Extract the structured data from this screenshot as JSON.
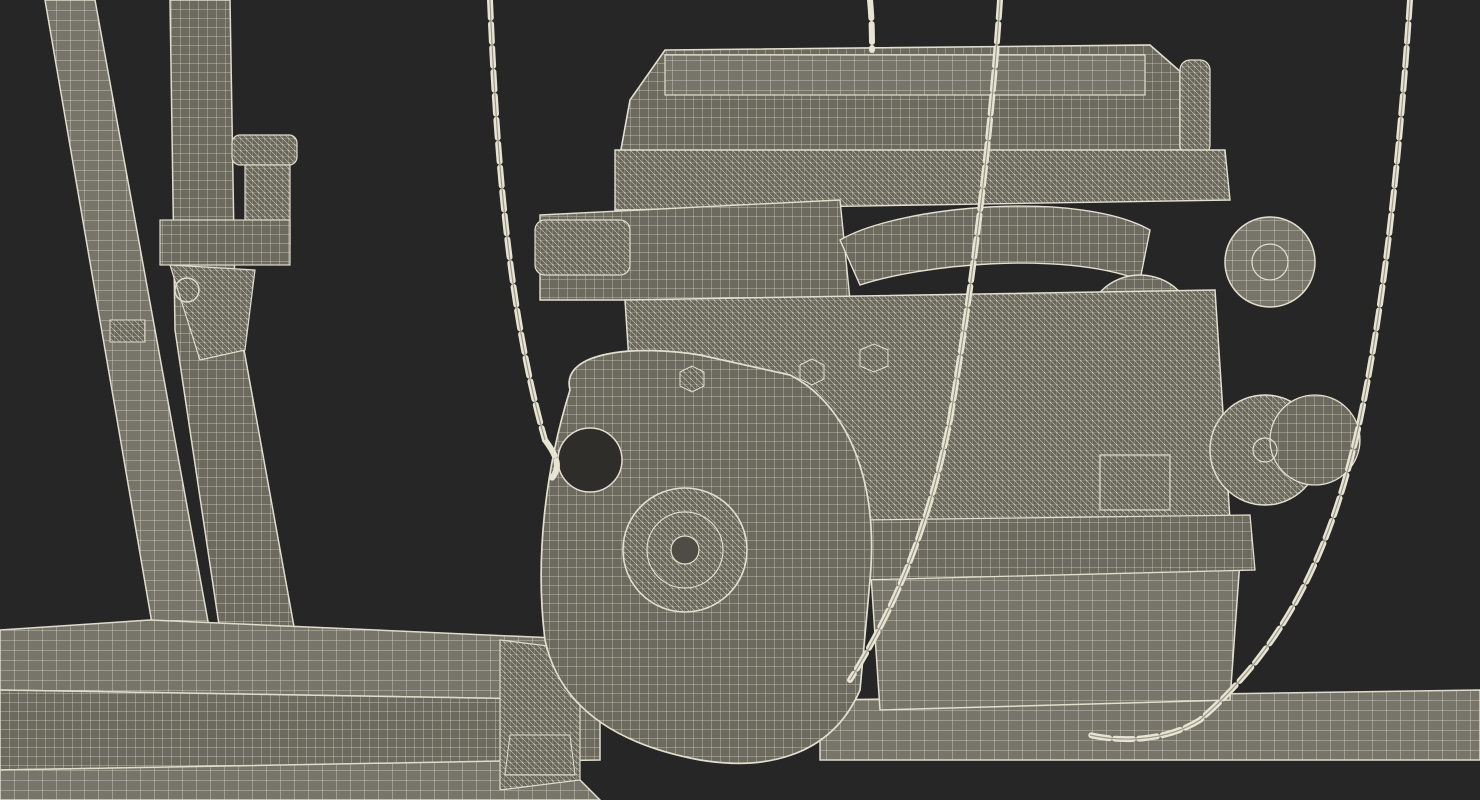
{
  "scene": {
    "background_color": "#262626",
    "model_fill_color": "#6f6c62",
    "wire_color": "#ddd9c8",
    "chain_color": "#e6e2d2",
    "subjects": [
      "engine-block-icon",
      "crane-boom-icon",
      "crane-frame-icon",
      "lifting-chain-icon"
    ]
  }
}
